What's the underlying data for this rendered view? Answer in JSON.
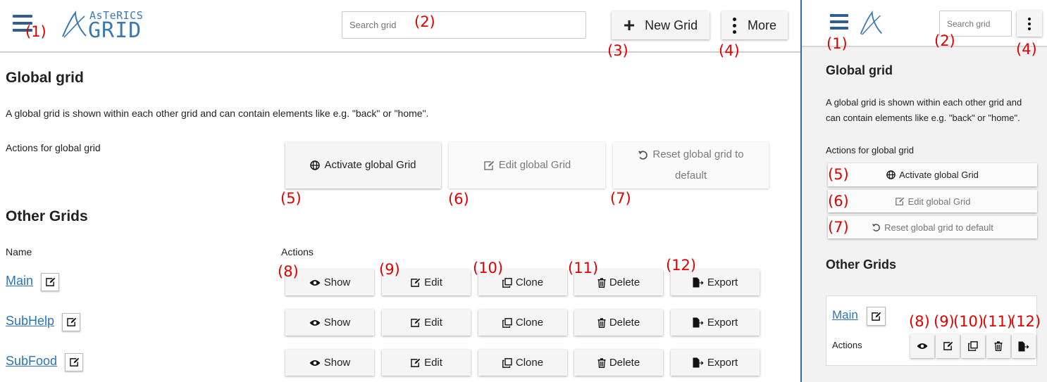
{
  "desktop": {
    "logo": {
      "brand_top": "AsTeRICS",
      "brand_bottom": "GRID"
    },
    "search": {
      "placeholder": "Search grid"
    },
    "header": {
      "new_grid_label": "New Grid",
      "more_label": "More"
    },
    "global": {
      "title": "Global grid",
      "description": "A global grid is shown within each other grid and can contain elements like e.g. \"back\" or \"home\".",
      "actions_label": "Actions for global grid",
      "activate_label": "Activate global Grid",
      "edit_label": "Edit global Grid",
      "reset_line1": "Reset global grid to",
      "reset_line2": "default"
    },
    "other": {
      "title": "Other Grids",
      "col_name": "Name",
      "col_actions": "Actions",
      "rows": [
        {
          "name": "Main"
        },
        {
          "name": "SubHelp"
        },
        {
          "name": "SubFood"
        }
      ],
      "actions": {
        "show": "Show",
        "edit": "Edit",
        "clone": "Clone",
        "delete": "Delete",
        "export": "Export"
      }
    }
  },
  "mobile": {
    "search": {
      "placeholder": "Search grid"
    },
    "global": {
      "title": "Global grid",
      "desc_line1": "A global grid is shown within each other grid and",
      "desc_line2": "can contain elements like e.g. \"back\" or \"home\".",
      "actions_label": "Actions for global grid",
      "activate_label": "Activate global Grid",
      "edit_label": "Edit global Grid",
      "reset_label": "Reset global grid to default"
    },
    "other": {
      "title": "Other Grids",
      "row_name": "Main",
      "actions_label": "Actions"
    }
  },
  "callouts": {
    "c1": "(1)",
    "c2": "(2)",
    "c3": "(3)",
    "c4": "(4)",
    "c5": "(5)",
    "c6": "(6)",
    "c7": "(7)",
    "c8": "(8)",
    "c9": "(9)",
    "c10": "(10)",
    "c11": "(11)",
    "c12": "(12)"
  },
  "colors": {
    "accent": "#3b78b4",
    "link": "#2f74b5",
    "callout": "#e00000",
    "divider": "#2a6cb5"
  }
}
